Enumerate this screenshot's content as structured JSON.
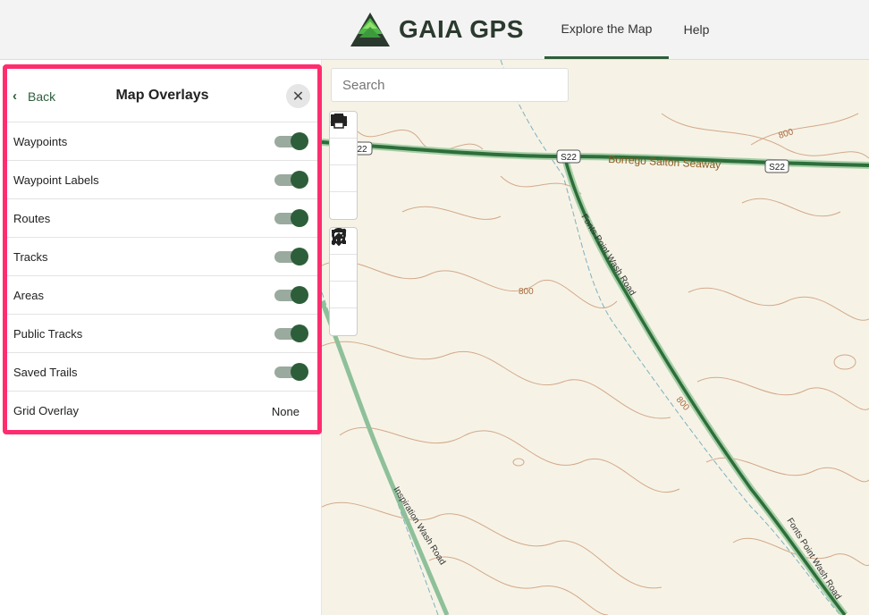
{
  "header": {
    "brand": "GAIA GPS",
    "nav": [
      {
        "label": "Explore the Map",
        "active": true
      },
      {
        "label": "Help",
        "active": false
      }
    ]
  },
  "search": {
    "placeholder": "Search"
  },
  "toolbar": {
    "group1": [
      "layers-icon",
      "folder-icon",
      "gear-icon",
      "print-icon"
    ],
    "group2": [
      "waypoint-pin-icon",
      "route-icon",
      "area-icon",
      "upload-icon"
    ]
  },
  "panel": {
    "back_label": "Back",
    "title": "Map Overlays",
    "close_icon": "close-icon",
    "rows": [
      {
        "label": "Waypoints",
        "on": true
      },
      {
        "label": "Waypoint Labels",
        "on": true
      },
      {
        "label": "Routes",
        "on": true
      },
      {
        "label": "Tracks",
        "on": true
      },
      {
        "label": "Areas",
        "on": true
      },
      {
        "label": "Public Tracks",
        "on": true
      },
      {
        "label": "Saved Trails",
        "on": true
      }
    ],
    "grid_overlay": {
      "label": "Grid Overlay",
      "value": "None"
    }
  },
  "map": {
    "road_name": "Borrego Salton Seaway",
    "shields": [
      "S22",
      "S22",
      "S22"
    ],
    "wash1": "Fonts Point Wash Road",
    "wash2": "Inspiration Wash Road",
    "contours": [
      "800",
      "800",
      "800"
    ]
  },
  "colors": {
    "accent": "#2d5e3a",
    "highlight": "#ff2d6f",
    "map_bg": "#f6f3e6",
    "contour": "#d4a88a"
  }
}
